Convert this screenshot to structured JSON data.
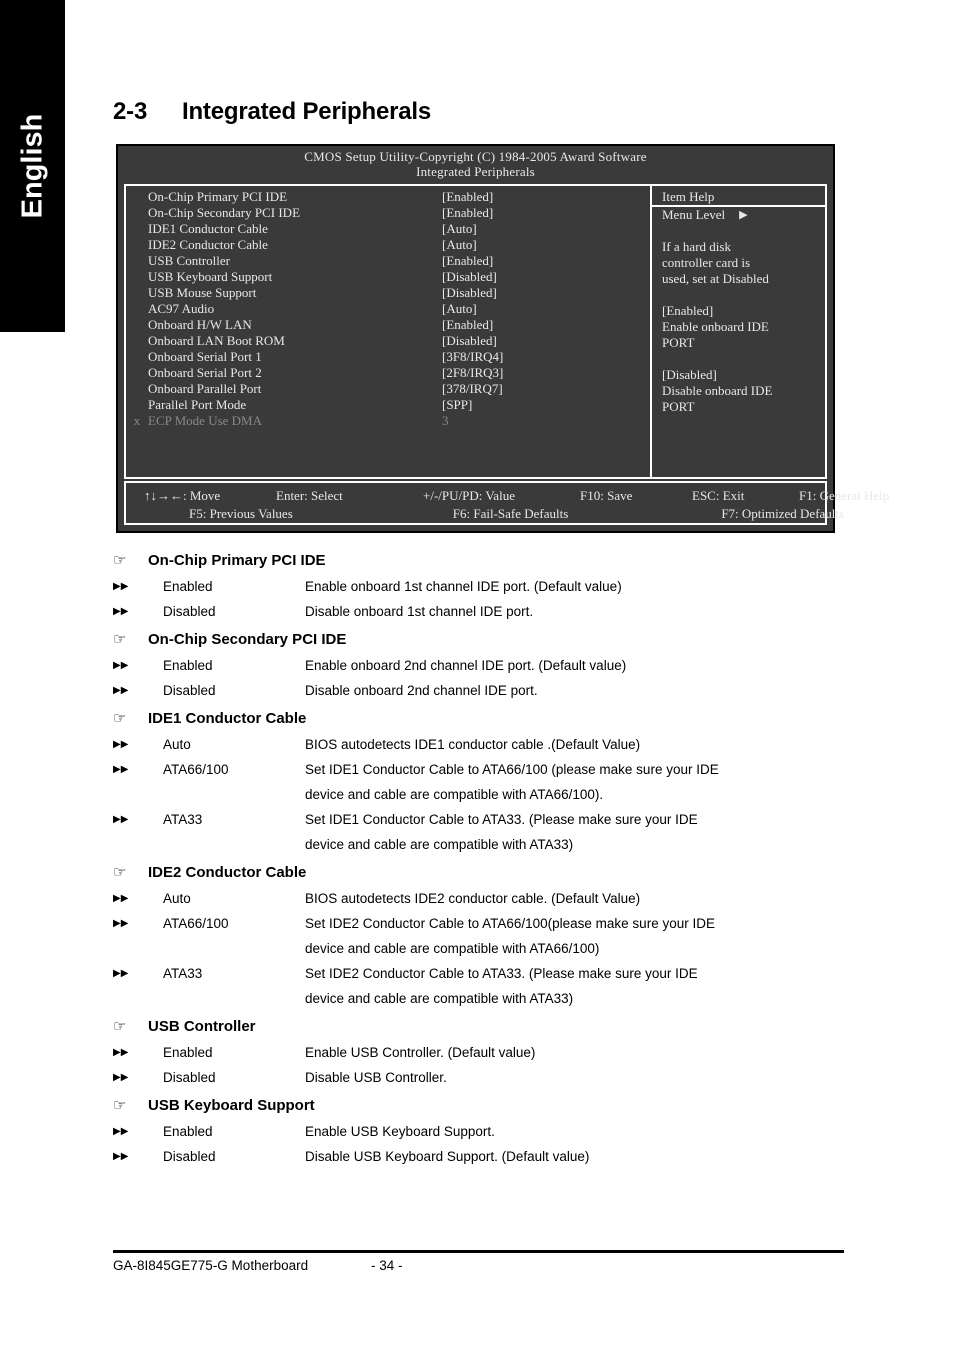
{
  "language_tab": {
    "label": "English"
  },
  "section": {
    "number": "2-3",
    "title": "Integrated Peripherals"
  },
  "bios": {
    "title_line1": "CMOS Setup Utility-Copyright (C) 1984-2005 Award Software",
    "title_line2": "Integrated Peripherals",
    "options": [
      {
        "flag": "",
        "name": "On-Chip Primary PCI IDE",
        "value": "[Enabled]",
        "dim": false
      },
      {
        "flag": "",
        "name": "On-Chip Secondary PCI IDE",
        "value": "[Enabled]",
        "dim": false
      },
      {
        "flag": "",
        "name": "IDE1 Conductor Cable",
        "value": "[Auto]",
        "dim": false
      },
      {
        "flag": "",
        "name": "IDE2 Conductor Cable",
        "value": "[Auto]",
        "dim": false
      },
      {
        "flag": "",
        "name": "USB Controller",
        "value": "[Enabled]",
        "dim": false
      },
      {
        "flag": "",
        "name": "USB Keyboard Support",
        "value": "[Disabled]",
        "dim": false
      },
      {
        "flag": "",
        "name": "USB Mouse Support",
        "value": "[Disabled]",
        "dim": false
      },
      {
        "flag": "",
        "name": "AC97 Audio",
        "value": "[Auto]",
        "dim": false
      },
      {
        "flag": "",
        "name": "Onboard H/W LAN",
        "value": "[Enabled]",
        "dim": false
      },
      {
        "flag": "",
        "name": "Onboard LAN Boot ROM",
        "value": "[Disabled]",
        "dim": false
      },
      {
        "flag": "",
        "name": "Onboard Serial Port 1",
        "value": "[3F8/IRQ4]",
        "dim": false
      },
      {
        "flag": "",
        "name": "Onboard Serial Port 2",
        "value": "[2F8/IRQ3]",
        "dim": false
      },
      {
        "flag": "",
        "name": "Onboard Parallel Port",
        "value": "[378/IRQ7]",
        "dim": false
      },
      {
        "flag": "",
        "name": "Parallel Port Mode",
        "value": "[SPP]",
        "dim": false
      },
      {
        "flag": "x",
        "name": "ECP Mode Use DMA",
        "value": "3",
        "dim": true
      }
    ],
    "item_help": {
      "title": "Item Help",
      "menu_level_label": "Menu Level",
      "menu_level_arrow": "▶",
      "lines": [
        "",
        "If a hard disk",
        "controller card is",
        "used, set at Disabled",
        "",
        "[Enabled]",
        "Enable onboard IDE",
        "PORT",
        "",
        "[Disabled]",
        "Disable onboard IDE",
        "PORT"
      ]
    },
    "footer": {
      "row1": [
        "↑↓→←: Move",
        "Enter: Select",
        "+/-/PU/PD: Value",
        "F10: Save",
        "ESC: Exit",
        "F1: General Help"
      ],
      "row2": [
        "F5: Previous Values",
        "F6: Fail-Safe Defaults",
        "F7: Optimized Defaults"
      ]
    }
  },
  "doc": {
    "hand_bullet": "☞",
    "sub_bullet": "▶▶",
    "groups": [
      {
        "heading": "On-Chip Primary PCI IDE",
        "rows": [
          {
            "option": "Enabled",
            "desc": "Enable onboard 1st channel IDE port. (Default value)",
            "desc2": ""
          },
          {
            "option": "Disabled",
            "desc": "Disable onboard 1st channel IDE port.",
            "desc2": ""
          }
        ]
      },
      {
        "heading": "On-Chip Secondary PCI IDE",
        "rows": [
          {
            "option": "Enabled",
            "desc": "Enable onboard 2nd channel IDE port. (Default value)",
            "desc2": ""
          },
          {
            "option": "Disabled",
            "desc": "Disable onboard 2nd channel IDE port.",
            "desc2": ""
          }
        ]
      },
      {
        "heading": "IDE1 Conductor Cable",
        "rows": [
          {
            "option": "Auto",
            "desc": "BIOS autodetects IDE1 conductor cable .(Default Value)",
            "desc2": ""
          },
          {
            "option": "ATA66/100",
            "desc": "Set IDE1 Conductor Cable to ATA66/100 (please make sure your IDE",
            "desc2": "device and cable are compatible with ATA66/100)."
          },
          {
            "option": "ATA33",
            "desc": "Set IDE1 Conductor Cable to ATA33. (Please make sure your IDE",
            "desc2": "device and cable are compatible with ATA33)"
          }
        ]
      },
      {
        "heading": "IDE2 Conductor Cable",
        "rows": [
          {
            "option": "Auto",
            "desc": "BIOS autodetects IDE2 conductor cable. (Default Value)",
            "desc2": ""
          },
          {
            "option": "ATA66/100",
            "desc": "Set IDE2 Conductor Cable to ATA66/100(please make sure your IDE",
            "desc2": "device and cable are compatible with ATA66/100)"
          },
          {
            "option": "ATA33",
            "desc": "Set IDE2 Conductor Cable to ATA33. (Please make sure your IDE",
            "desc2": "device and cable are compatible with ATA33)"
          }
        ]
      },
      {
        "heading": "USB Controller",
        "rows": [
          {
            "option": "Enabled",
            "desc": "Enable USB Controller. (Default value)",
            "desc2": ""
          },
          {
            "option": "Disabled",
            "desc": "Disable USB Controller.",
            "desc2": ""
          }
        ]
      },
      {
        "heading": "USB Keyboard Support",
        "rows": [
          {
            "option": "Enabled",
            "desc": "Enable USB Keyboard Support.",
            "desc2": ""
          },
          {
            "option": "Disabled",
            "desc": "Disable USB Keyboard Support. (Default value)",
            "desc2": ""
          }
        ]
      }
    ]
  },
  "page_footer": {
    "product": "GA-8I845GE775-G Motherboard",
    "page_number": "- 34 -"
  }
}
